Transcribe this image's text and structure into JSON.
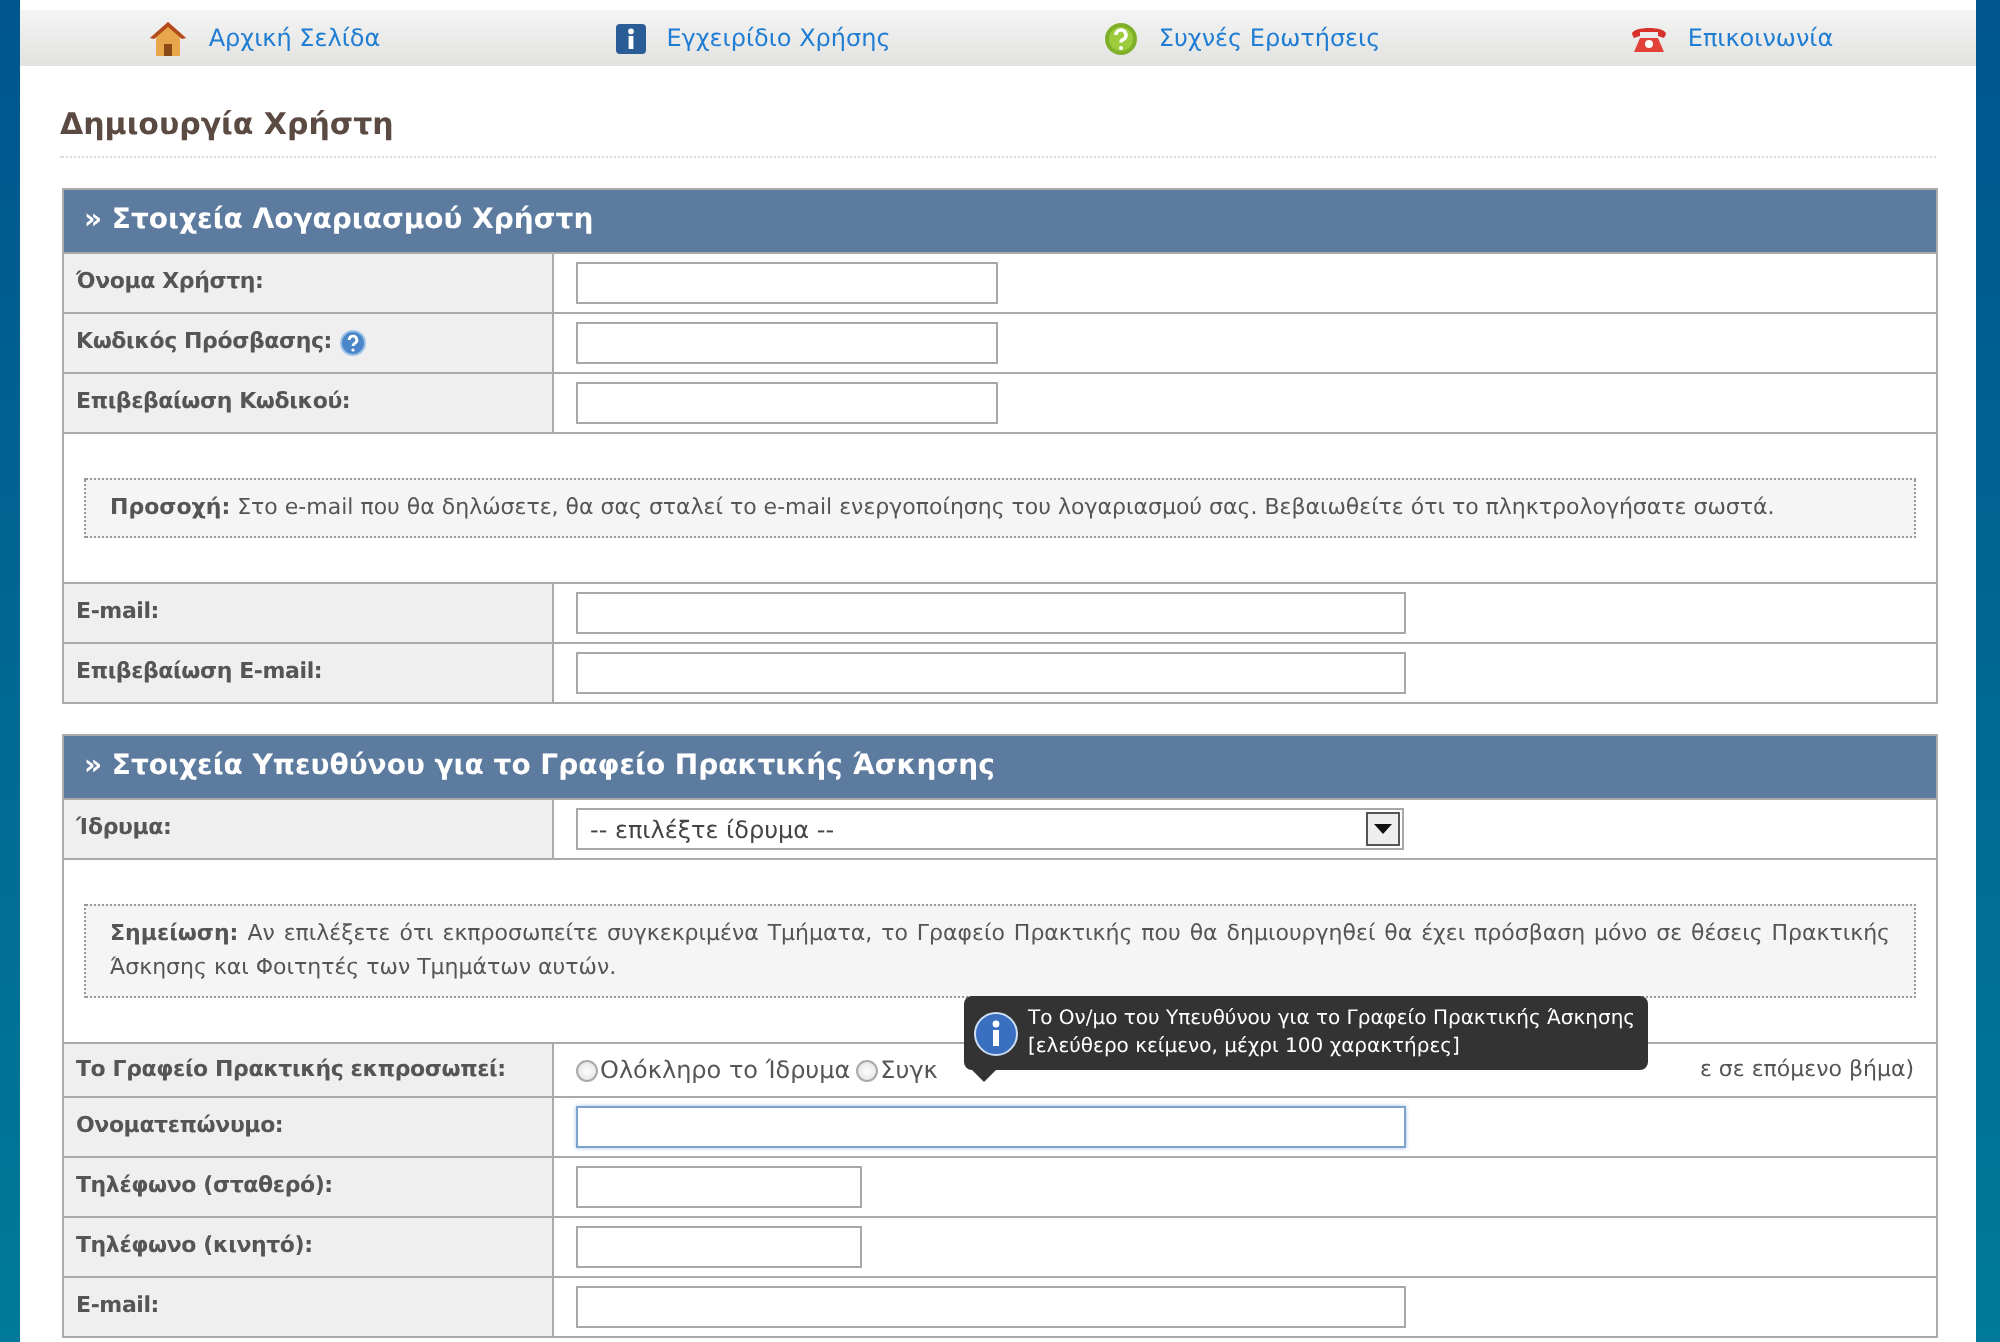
{
  "nav": [
    {
      "label": "Αρχική Σελίδα"
    },
    {
      "label": "Εγχειρίδιο Χρήσης"
    },
    {
      "label": "Συχνές Ερωτήσεις"
    },
    {
      "label": "Επικοινωνία"
    }
  ],
  "page_title": "Δημιουργία Χρήστη",
  "sections": [
    {
      "title": "» Στοιχεία Λογαριασμού Χρήστη",
      "rows": [
        {
          "kind": "text",
          "label": "Όνομα Χρήστη:",
          "help": false,
          "focused": false
        },
        {
          "kind": "text",
          "label": "Κωδικός Πρόσβασης:",
          "help": true,
          "focused": false
        },
        {
          "kind": "text",
          "label": "Επιβεβαίωση Κωδικού:",
          "help": false,
          "focused": false
        },
        {
          "kind": "note",
          "lead": "Προσοχή:",
          "text": "Στο e-mail που θα δηλώσετε, θα σας σταλεί το e-mail ενεργοποίησης του λογαριασμού σας. Βεβαιωθείτε ότι το πληκτρολογήσατε σωστά."
        },
        {
          "kind": "wide",
          "label": "E-mail:",
          "help": false,
          "focused": false
        },
        {
          "kind": "wide",
          "label": "Επιβεβαίωση E-mail:",
          "help": false,
          "focused": false
        }
      ]
    },
    {
      "title": "» Στοιχεία Υπευθύνου για το Γραφείο Πρακτικής Άσκησης",
      "rows": [
        {
          "kind": "select",
          "label": "Ίδρυμα:",
          "value": "-- επιλέξτε ίδρυμα --"
        },
        {
          "kind": "note",
          "lead": "Σημείωση:",
          "text": "Αν επιλέξετε ότι εκπροσωπείτε συγκεκριμένα Τμήματα, το Γραφείο Πρακτικής που θα δημιουργηθεί θα έχει πρόσβαση μόνο σε θέσεις Πρακτικής Άσκησης και Φοιτητές των Τμημάτων αυτών."
        },
        {
          "kind": "radios",
          "label": "Το Γραφείο Πρακτικής εκπροσωπεί:",
          "options": [
            {
              "label": "Ολόκληρο το Ίδρυμα",
              "selected": false
            },
            {
              "label": "Συγκ",
              "selected": false
            }
          ],
          "trailing": "ε σε επόμενο βήμα)"
        },
        {
          "kind": "wide",
          "label": "Ονοματεπώνυμο:",
          "help": false,
          "focused": true
        },
        {
          "kind": "phone",
          "label": "Τηλέφωνο (σταθερό):",
          "help": false,
          "focused": false
        },
        {
          "kind": "phone",
          "label": "Τηλέφωνο (κινητό):",
          "help": false,
          "focused": false
        },
        {
          "kind": "wide",
          "label": "E-mail:",
          "help": false,
          "focused": false
        }
      ]
    }
  ],
  "tooltip": {
    "lines": [
      "Το Ον/μο του Υπευθύνου για το Γραφείο Πρακτικής Άσκησης",
      "[ελεύθερο κείμενο, μέχρι 100 χαρακτήρες]"
    ]
  }
}
